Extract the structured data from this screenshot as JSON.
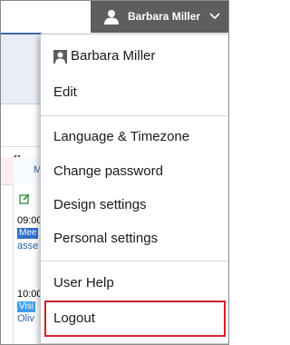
{
  "header": {
    "user_name": "Barbara Miller"
  },
  "background": {
    "day_label": "M",
    "events": [
      {
        "time": "09:00",
        "tag": "Mee",
        "title": "asse"
      },
      {
        "time": "10:00",
        "tag": "Visi",
        "title": "Oliv"
      }
    ]
  },
  "menu": {
    "profile_name": "Barbara Miller",
    "items": [
      {
        "label": "Edit"
      },
      {
        "label": "Language & Timezone"
      },
      {
        "label": "Change password"
      },
      {
        "label": "Design settings"
      },
      {
        "label": "Personal settings"
      },
      {
        "label": "User Help"
      },
      {
        "label": "Logout"
      }
    ]
  },
  "colors": {
    "header_bg": "#5e5e5e",
    "highlight_border": "#d2222d",
    "brand_blue": "#3a66b0"
  }
}
